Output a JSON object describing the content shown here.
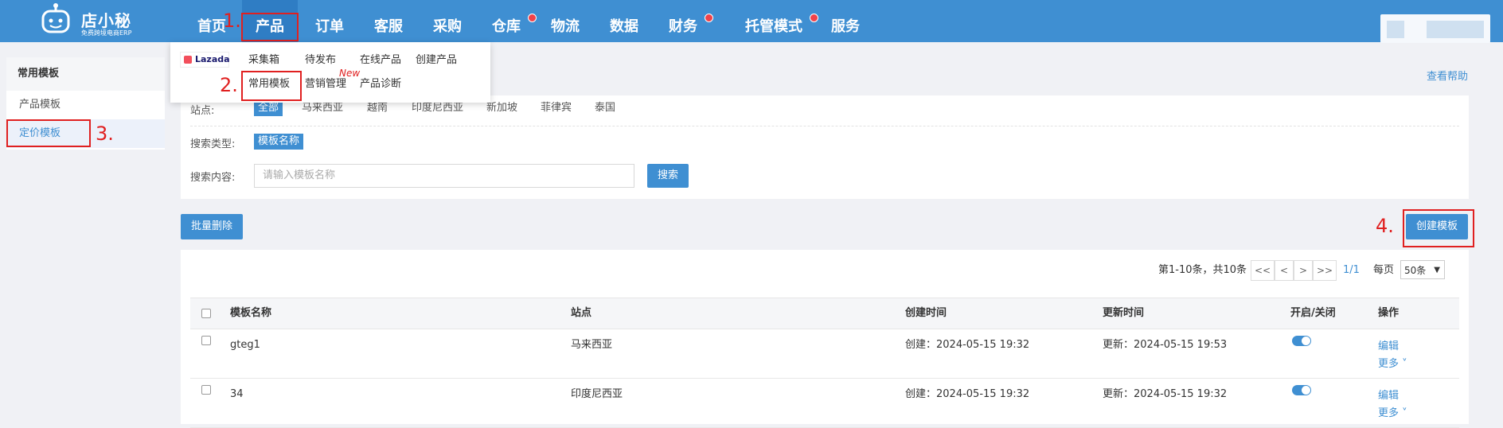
{
  "brand": {
    "name": "店小秘",
    "subtitle": "免费跨境电商ERP"
  },
  "nav": [
    {
      "label": "首页",
      "dot": false
    },
    {
      "label": "产品",
      "dot": false
    },
    {
      "label": "订单",
      "dot": false
    },
    {
      "label": "客服",
      "dot": false
    },
    {
      "label": "采购",
      "dot": false
    },
    {
      "label": "仓库",
      "dot": true
    },
    {
      "label": "物流",
      "dot": false
    },
    {
      "label": "数据",
      "dot": false
    },
    {
      "label": "财务",
      "dot": true
    },
    {
      "label": "托管模式",
      "dot": true
    },
    {
      "label": "服务",
      "dot": false
    }
  ],
  "dropdown": {
    "platform": "Lazada",
    "row1": [
      "采集箱",
      "待发布",
      "在线产品",
      "创建产品"
    ],
    "row2": [
      "常用模板",
      "营销管理",
      "产品诊断"
    ],
    "new_badge": "New"
  },
  "annotations": [
    "1.",
    "2.",
    "3.",
    "4."
  ],
  "sidebar": {
    "title": "常用模板",
    "items": [
      {
        "label": "产品模板"
      },
      {
        "label": "定价模板"
      }
    ]
  },
  "help_link": "查看帮助",
  "filter": {
    "site_label": "站点:",
    "sites": [
      "全部",
      "马来西亚",
      "越南",
      "印度尼西亚",
      "新加坡",
      "菲律宾",
      "泰国"
    ],
    "search_type_label": "搜索类型:",
    "search_type_value": "模板名称",
    "search_content_label": "搜索内容:",
    "search_placeholder": "请输入模板名称",
    "search_button": "搜索"
  },
  "actions": {
    "batch_delete": "批量删除",
    "create_template": "创建模板"
  },
  "pager": {
    "summary": "第1-10条，共10条",
    "first": "<<",
    "prev": "<",
    "next": ">",
    "last": ">>",
    "page": "1/1",
    "per_page_label": "每页",
    "per_page_value": "50条"
  },
  "table": {
    "headers": [
      "模板名称",
      "站点",
      "创建时间",
      "更新时间",
      "开启/关闭",
      "操作"
    ],
    "rows": [
      {
        "name": "gteg1",
        "site": "马来西亚",
        "created": "创建：2024-05-15 19:32",
        "updated": "更新：2024-05-15 19:53",
        "enabled": true,
        "edit": "编辑",
        "more": "更多"
      },
      {
        "name": "34",
        "site": "印度尼西亚",
        "created": "创建：2024-05-15 19:32",
        "updated": "更新：2024-05-15 19:32",
        "enabled": true,
        "edit": "编辑",
        "more": "更多"
      }
    ]
  },
  "colors": {
    "primary": "#3f8fd2",
    "annotation": "#e02020",
    "dot": "#f0424a"
  }
}
